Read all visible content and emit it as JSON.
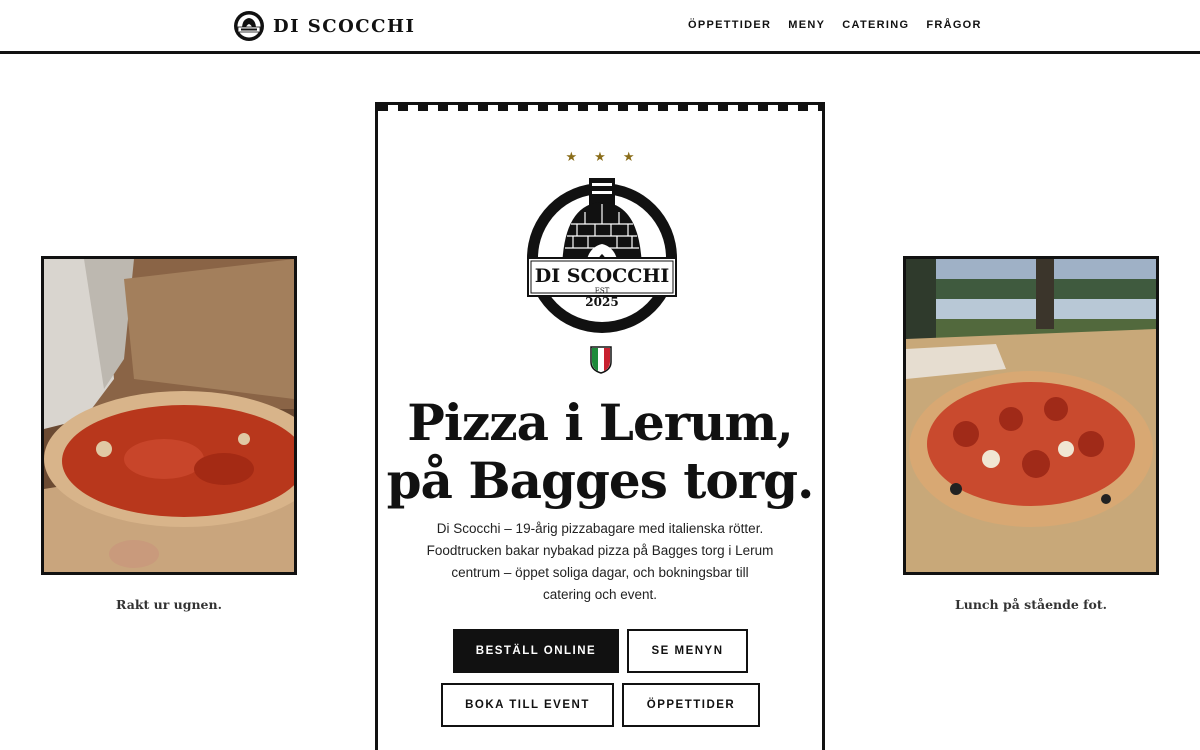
{
  "header": {
    "brand_name": "DI SCOCCHI",
    "nav": [
      "ÖPPETTIDER",
      "MENY",
      "CATERING",
      "FRÅGOR"
    ]
  },
  "hero": {
    "stars": [
      "★",
      "★",
      "★"
    ],
    "emblem": {
      "name": "DI SCOCCHI",
      "est": "EST",
      "year": "2025"
    },
    "headline_line1": "Pizza i Lerum,",
    "headline_line2": "på Bagges torg.",
    "intro_lines": [
      "Di Scocchi – 19-årig pizzabagare med italienska rötter.",
      "Foodtrucken bakar nybakad pizza på Bagges torg i Lerum",
      "centrum – öppet soliga dagar, och bokningsbar till",
      "catering och event."
    ],
    "buttons": {
      "order": "BESTÄLL ONLINE",
      "menu": "SE MENYN",
      "event": "BOKA TILL EVENT",
      "hours": "ÖPPETTIDER"
    }
  },
  "photos": {
    "left_caption": "Rakt ur ugnen.",
    "right_caption": "Lunch på stående fot."
  },
  "colors": {
    "ink": "#111111",
    "gold_star": "#8a6d1a",
    "flag_green": "#1e8a3a",
    "flag_red": "#c8202f"
  }
}
